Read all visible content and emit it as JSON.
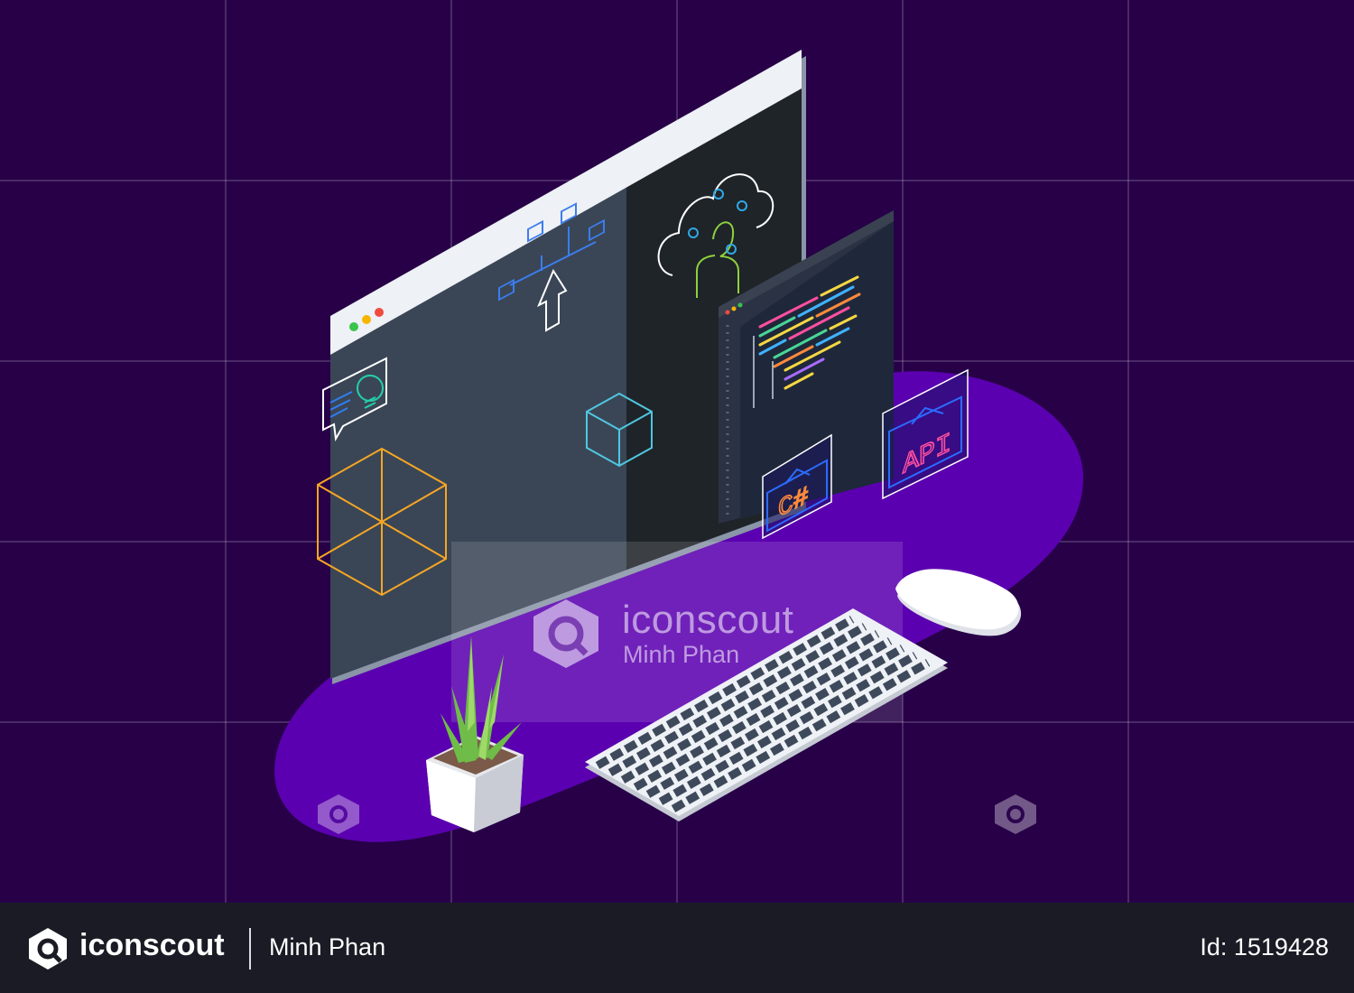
{
  "scene": {
    "background_color": "#270048",
    "platform_color": "#5b00b0",
    "api_badge_label": "API",
    "csharp_badge_label": "C#"
  },
  "watermark": {
    "brand": "iconscout",
    "author": "Minh Phan"
  },
  "footer": {
    "brand": "iconscout",
    "author": "Minh Phan",
    "id_text": "Id: 1519428"
  }
}
